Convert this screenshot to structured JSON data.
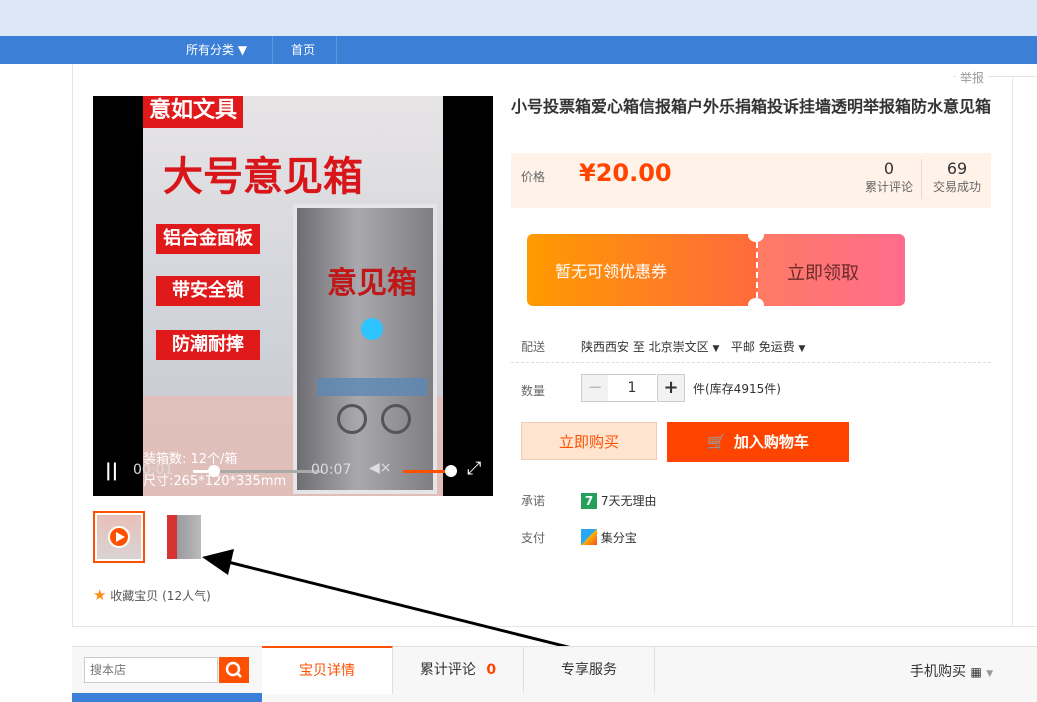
{
  "nav": {
    "categories_label": "所有分类 ▼",
    "home_label": "首页"
  },
  "report_label": "举报",
  "video": {
    "poster_tag_top": "意如文具",
    "poster_headline": "大号意见箱",
    "features": [
      "铝合金面板",
      "带安全锁",
      "防潮耐摔"
    ],
    "box_label": "意见箱",
    "spec_line1": "装箱数: 12个/箱",
    "spec_line2": "尺寸:265*120*335mm",
    "current_time": "00:01",
    "duration": "00:07",
    "progress": 0.16,
    "volume": 1.0
  },
  "favorite": {
    "label": "收藏宝贝",
    "count": "(12人气)"
  },
  "product": {
    "title": "小号投票箱爱心箱信报箱户外乐捐箱投诉挂墙透明举报箱防水意见箱",
    "price_label": "价格",
    "price": "¥20.00",
    "reviews_count": "0",
    "reviews_label": "累计评论",
    "sales_count": "69",
    "sales_label": "交易成功"
  },
  "coupon": {
    "left_text": "暂无可领优惠券",
    "right_text": "立即领取"
  },
  "delivery": {
    "label": "配送",
    "origin": "陕西西安 至",
    "destination": "北京崇文区",
    "shipping": "平邮 免运费"
  },
  "quantity": {
    "label": "数量",
    "minus": "−",
    "value": "1",
    "plus": "+",
    "stock_text": "件(库存4915件)"
  },
  "buttons": {
    "buy_now": "立即购买",
    "add_to_cart": "加入购物车"
  },
  "promise": {
    "label": "承诺",
    "badge": "7",
    "text": "7天无理由"
  },
  "payment": {
    "label": "支付",
    "text": "集分宝"
  },
  "bottom": {
    "search_placeholder": "搜本店",
    "tabs": [
      {
        "label": "宝贝详情"
      },
      {
        "label": "累计评论",
        "count": "0"
      },
      {
        "label": "专享服务"
      }
    ],
    "mobile_buy": "手机购买"
  }
}
